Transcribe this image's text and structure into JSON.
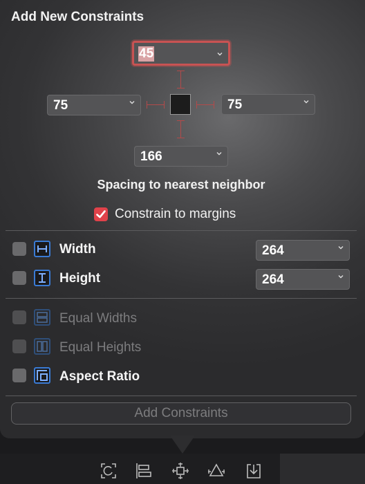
{
  "panel": {
    "title": "Add New Constraints",
    "spacing_caption": "Spacing to nearest neighbor",
    "constrain_to_margins": {
      "label": "Constrain to margins",
      "checked": true
    }
  },
  "spacing": {
    "top": "45",
    "left": "75",
    "right": "75",
    "bottom": "166"
  },
  "size_rows": [
    {
      "label": "Width",
      "value": "264",
      "checked": false,
      "icon": "width-icon"
    },
    {
      "label": "Height",
      "value": "264",
      "checked": false,
      "icon": "height-icon"
    }
  ],
  "option_rows": [
    {
      "label": "Equal Widths",
      "checked": false,
      "enabled": false,
      "icon": "equal-widths-icon"
    },
    {
      "label": "Equal Heights",
      "checked": false,
      "enabled": false,
      "icon": "equal-heights-icon"
    },
    {
      "label": "Aspect Ratio",
      "checked": false,
      "enabled": true,
      "icon": "aspect-ratio-icon"
    }
  ],
  "add_button_label": "Add Constraints",
  "toolbar_icons": [
    "update-frames-icon",
    "align-icon",
    "add-constraints-icon",
    "resolve-issues-icon",
    "embed-icon"
  ],
  "colors": {
    "accent": "#e0424a",
    "strut": "#b34a4a",
    "icon_blue": "#3a7bd5"
  }
}
